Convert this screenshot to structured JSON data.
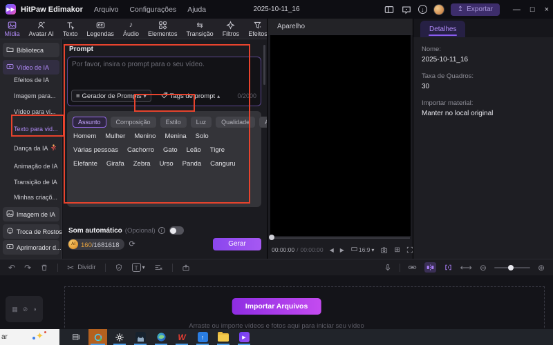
{
  "titlebar": {
    "app_name": "HitPaw Edimakor",
    "menus": [
      "Arquivo",
      "Configurações",
      "Ajuda"
    ],
    "document_title": "2025-10-11_16",
    "export_label": "Exportar"
  },
  "ribbon": {
    "tabs": [
      {
        "label": "Mídia",
        "active": true
      },
      {
        "label": "Avatar AI"
      },
      {
        "label": "Texto"
      },
      {
        "label": "Legendas"
      },
      {
        "label": "Áudio"
      },
      {
        "label": "Elementos"
      },
      {
        "label": "Transição"
      },
      {
        "label": "Filtros"
      },
      {
        "label": "Efeitos"
      }
    ]
  },
  "sidebar": {
    "items": [
      {
        "label": "Biblioteca"
      },
      {
        "label": "Vídeo de IA",
        "active": true
      },
      {
        "label": "Efeitos de IA"
      },
      {
        "label": "Imagem para..."
      },
      {
        "label": "Vídeo para vi..."
      },
      {
        "label": "Texto para vid...",
        "selected": true
      },
      {
        "label": "Dança da IA"
      },
      {
        "label": "Animação de IA"
      },
      {
        "label": "Transição de IA"
      },
      {
        "label": "Minhas criaçõ..."
      },
      {
        "label": "Imagem de IA"
      },
      {
        "label": "Troca de Rostos"
      },
      {
        "label": "Aprimorador d..."
      }
    ]
  },
  "prompt_panel": {
    "title": "Prompt",
    "placeholder": "Por favor, insira o prompt para o seu vídeo.",
    "generator_button": "Gerador de Prompts",
    "tags_button": "Tags de prompt",
    "char_counter": "0/2000",
    "categories": [
      {
        "label": "Assunto",
        "active": true
      },
      {
        "label": "Composição"
      },
      {
        "label": "Estilo"
      },
      {
        "label": "Luz"
      },
      {
        "label": "Qualidade"
      },
      {
        "label": "Atmosfera"
      }
    ],
    "tags": [
      "Homem",
      "Mulher",
      "Menino",
      "Menina",
      "Solo",
      "Várias pessoas",
      "Cachorro",
      "Gato",
      "Leão",
      "Tigre",
      "Elefante",
      "Girafa",
      "Zebra",
      "Urso",
      "Panda",
      "Canguru"
    ],
    "auto_sound_label": "Som automático",
    "auto_sound_optional": "(Opcional)",
    "credits": {
      "used": "160",
      "total": "/1681618"
    },
    "generate_button": "Gerar"
  },
  "preview": {
    "title": "Aparelho",
    "time_current": "00:00:00",
    "time_divider": "/",
    "time_total": "00:00:00",
    "aspect_ratio": "16:9"
  },
  "details_panel": {
    "tab": "Detalhes",
    "fields": [
      {
        "label": "Nome:",
        "value": "2025-10-11_16"
      },
      {
        "label": "Taxa de Quadros:",
        "value": "30"
      },
      {
        "label": "Importar material:",
        "value": "Manter no local original"
      }
    ]
  },
  "timeline_toolbar": {
    "split_label": "Dividir"
  },
  "timeline": {
    "import_button": "Importar Arquivos",
    "drop_hint": "Arraste ou importe vídeos e fotos aqui para iniciar seu vídeo"
  },
  "taskbar": {
    "search_text": "ar"
  },
  "icons": {
    "minimize": "—",
    "maximize": "□",
    "close": "×",
    "export_arrow": "↥",
    "download_arrow": "↓",
    "note": "♪",
    "transition_arrows": "⇆",
    "undo": "↶",
    "redo": "↷",
    "scissors": "✂",
    "caret_down": "▾",
    "caret_up": "▴",
    "text_tool": "T",
    "prev_frame": "◀",
    "play": "▶",
    "grid": "⊞",
    "expand": "⟷",
    "zoom_out": "⊖",
    "zoom_in": "⊕",
    "refresh": "⟳",
    "menu_lines": "≡",
    "info": "i",
    "coin_text": "AI",
    "track_type": "▦",
    "track_hide": "⊘",
    "track_lock": "◑",
    "sparkle_star": "✦",
    "wps_w": "W",
    "doc_arrow": "↑"
  },
  "colors": {
    "accent": "#9b6bf5",
    "annotation_red": "#e8432d",
    "generate_gradient": "#8a46ee → #a658f2",
    "import_gradient": "#8e2de2 → #c44bf0",
    "coin_gold": "#e8a33d",
    "taskbar_indicator_blue": "#4f9fe8"
  }
}
